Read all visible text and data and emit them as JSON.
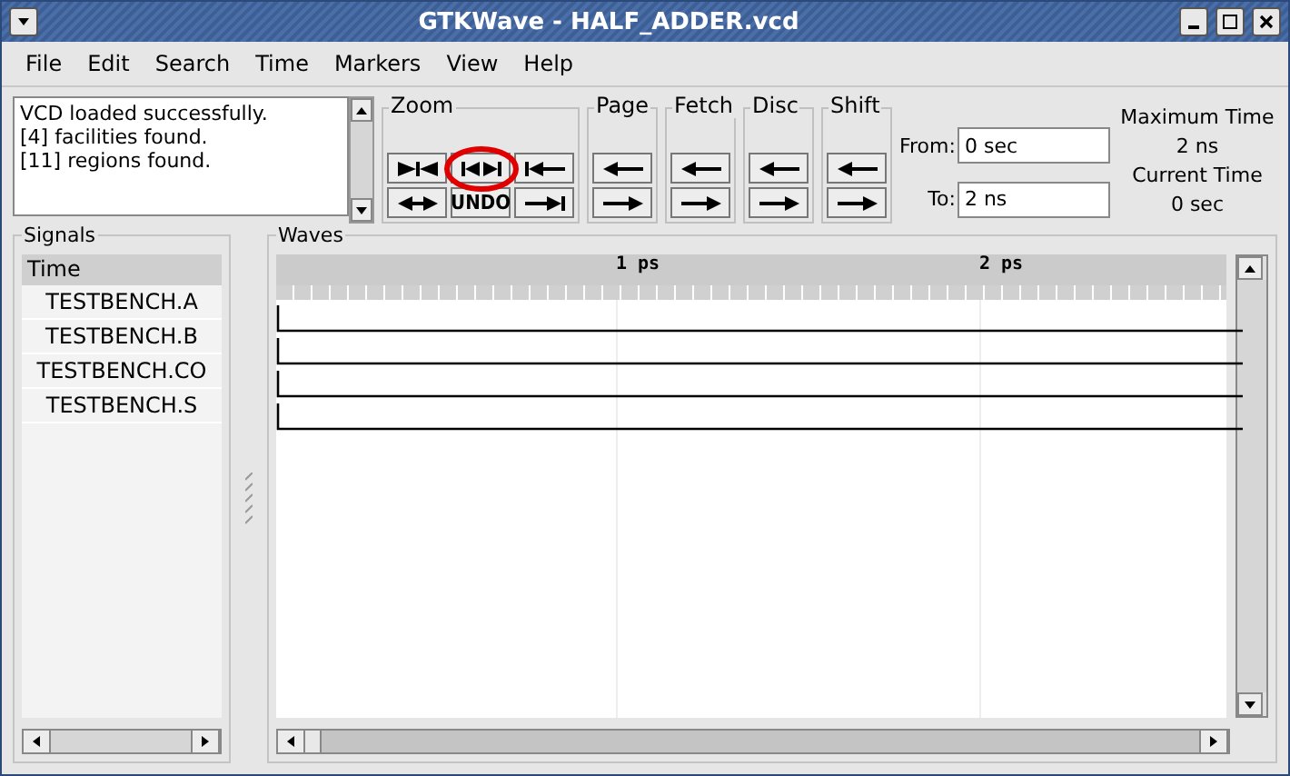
{
  "window": {
    "title": "GTKWave - HALF_ADDER.vcd"
  },
  "menu": [
    "File",
    "Edit",
    "Search",
    "Time",
    "Markers",
    "View",
    "Help"
  ],
  "log": [
    "VCD loaded successfully.",
    "[4] facilities found.",
    "[11] regions found."
  ],
  "groups": [
    {
      "label": "Zoom",
      "buttons": [
        {
          "kind": "fit"
        },
        {
          "kind": "zoom-in",
          "highlighted": true
        },
        {
          "kind": "start"
        },
        {
          "kind": "zoom-out"
        },
        {
          "kind": "text",
          "label": "UNDO"
        },
        {
          "kind": "end"
        }
      ]
    },
    {
      "label": "Page",
      "buttons": [
        {
          "kind": "left"
        },
        {
          "kind": "right"
        }
      ]
    },
    {
      "label": "Fetch",
      "buttons": [
        {
          "kind": "left"
        },
        {
          "kind": "right"
        }
      ]
    },
    {
      "label": "Disc",
      "buttons": [
        {
          "kind": "left"
        },
        {
          "kind": "right"
        }
      ]
    },
    {
      "label": "Shift",
      "buttons": [
        {
          "kind": "left"
        },
        {
          "kind": "right"
        }
      ]
    }
  ],
  "range": {
    "from_label": "From:",
    "from_value": "0 sec",
    "to_label": "To:",
    "to_value": "2 ns"
  },
  "info": {
    "max_label": "Maximum Time",
    "max_value": "2 ns",
    "current_label": "Current Time",
    "current_value": "0 sec"
  },
  "signals": {
    "title": "Signals",
    "header": "Time",
    "items": [
      "TESTBENCH.A",
      "TESTBENCH.B",
      "TESTBENCH.CO",
      "TESTBENCH.S"
    ]
  },
  "waves": {
    "title": "Waves",
    "ticks": [
      "1 ps",
      "2 ps"
    ],
    "rows": [
      {
        "high": false
      },
      {
        "high": false
      },
      {
        "high": false
      },
      {
        "high": false
      }
    ]
  }
}
